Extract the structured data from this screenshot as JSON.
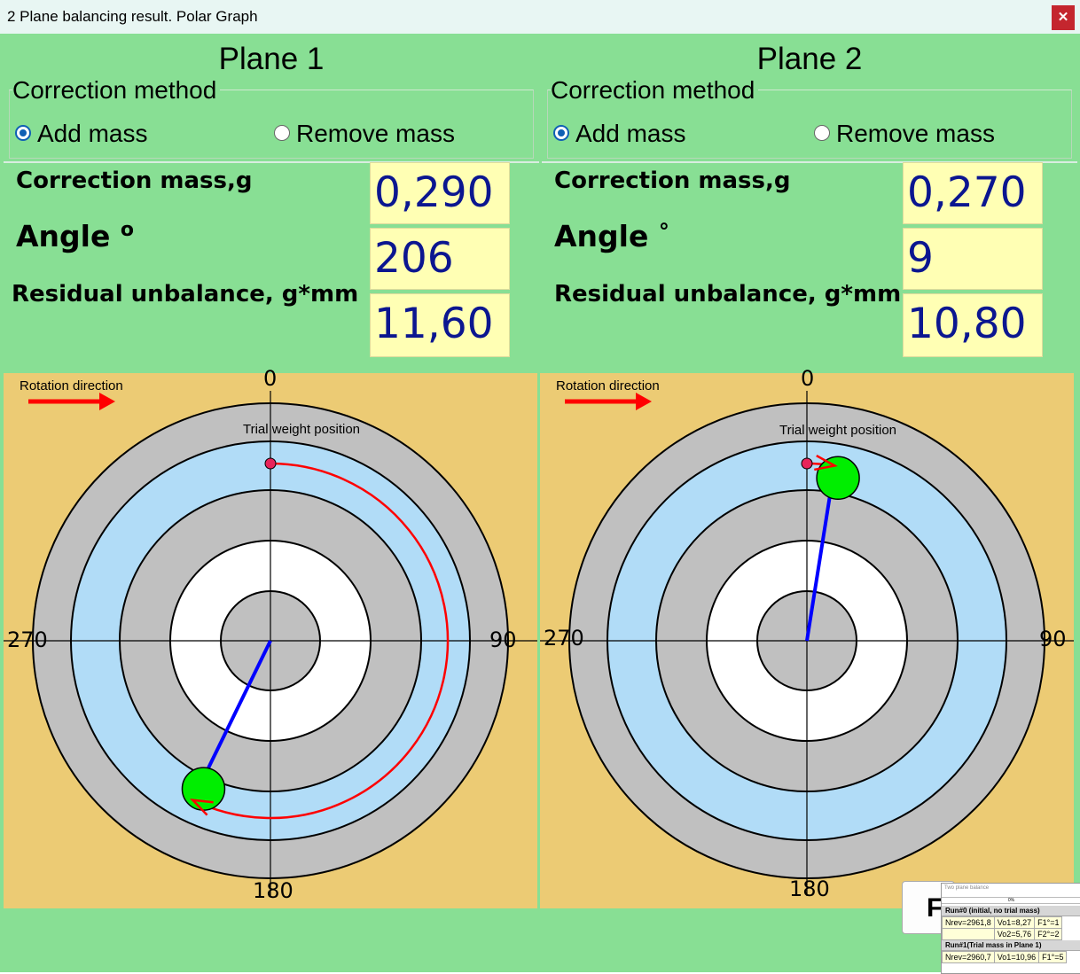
{
  "window": {
    "title": "2 Plane balancing result. Polar Graph",
    "close_icon": "close-icon"
  },
  "planes": [
    {
      "title": "Plane 1",
      "correction_method_label": "Correction method",
      "add_mass_label": "Add mass",
      "remove_mass_label": "Remove mass",
      "selected_method": "Add mass",
      "correction_mass_label": "Correction mass,g",
      "correction_mass": "0,290",
      "angle_label": "Angle",
      "angle_unit": "o",
      "angle": "206",
      "residual_label": "Residual unbalance, g*mm",
      "residual": "11,60",
      "graph": {
        "rotation_label": "Rotation direction",
        "trial_label": "Trial weight position",
        "axis_labels": {
          "top": "0",
          "right": "90",
          "bottom": "180",
          "left": "270"
        },
        "correction_angle_deg": 206,
        "vector_relative_length": 0.65,
        "arc_from_deg": 0,
        "arc_to_deg": 206
      }
    },
    {
      "title": "Plane 2",
      "correction_method_label": "Correction method",
      "add_mass_label": "Add mass",
      "remove_mass_label": "Remove mass",
      "selected_method": "Add mass",
      "correction_mass_label": "Correction mass,g",
      "correction_mass": "0,270",
      "angle_label": "Angle",
      "angle_unit": "°",
      "angle": "9",
      "residual_label": "Residual unbalance, g*mm",
      "residual": "10,80",
      "graph": {
        "rotation_label": "Rotation direction",
        "trial_label": "Trial weight position",
        "axis_labels": {
          "top": "0",
          "right": "90",
          "bottom": "180",
          "left": "270"
        },
        "correction_angle_deg": 9,
        "vector_relative_length": 0.65,
        "arc_from_deg": 0,
        "arc_to_deg": 9
      }
    }
  ],
  "colors": {
    "panel_bg": "#88df94",
    "graph_bg": "#eccb74",
    "ring_gray": "#c0c0c0",
    "ring_blue": "#b1dcf7",
    "ring_white": "#ffffff",
    "value_bg": "#ffffb4",
    "value_text": "#0b1690",
    "vector": "#0000ff",
    "arc": "#ff0000",
    "correction_marker": "#00ee00",
    "trial_marker": "#e8245a"
  },
  "bottom": {
    "button_label": "F"
  },
  "thumbnail": {
    "title": "Two plane balance",
    "progress": "0%",
    "runs": [
      {
        "header": "Run#0 (initial, no trial mass)",
        "cells": [
          [
            "Nrev=2961,8",
            "Vo1=8,27",
            "F1°=1"
          ],
          [
            "",
            "Vo2=5,76",
            "F2°=2"
          ]
        ]
      },
      {
        "header": "Run#1(Trial mass in Plane 1)",
        "cells": [
          [
            "Nrev=2960,7",
            "Vo1=10,96",
            "F1°=5"
          ]
        ]
      }
    ]
  }
}
